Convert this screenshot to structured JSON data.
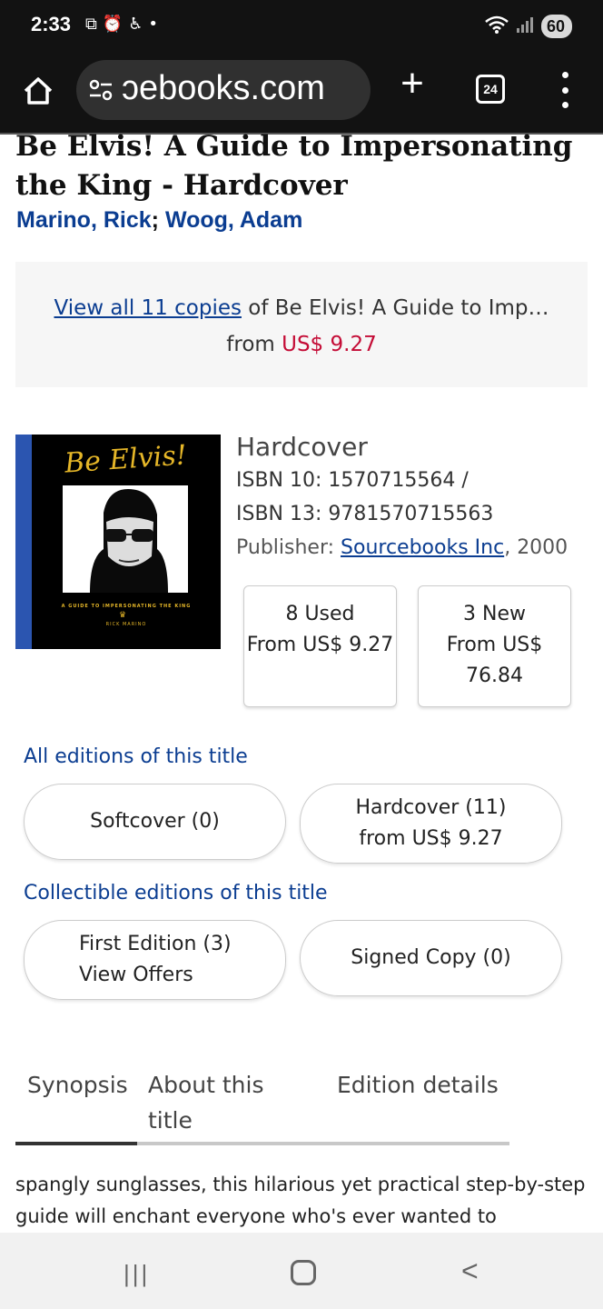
{
  "status_bar": {
    "time": "2:33",
    "battery": "60",
    "notification_icons": [
      "screenshot-icon",
      "alarm-icon",
      "accessibility-icon",
      "dot-icon"
    ]
  },
  "browser": {
    "url": "ɔebooks.com",
    "tab_count": "24"
  },
  "book": {
    "title": "Be Elvis! A Guide to Impersonating the King - Hardcover",
    "author1": "Marino, Rick",
    "author_sep": ";",
    "author2": "Woog, Adam"
  },
  "copies": {
    "link_text": "View all 11 copies",
    "rest_text": " of Be Elvis! A Guide to Imp…",
    "from_text": "from ",
    "price": "US$ 9.27"
  },
  "cover": {
    "title": "Be Elvis!",
    "subtitle": "A GUIDE TO IMPERSONATING THE KING",
    "author": "RICK MARINO"
  },
  "details": {
    "format": "Hardcover",
    "isbn10": "ISBN 10: 1570715564 /",
    "isbn13": "ISBN 13: 9781570715563",
    "publisher_label": "Publisher: ",
    "publisher": "Sourcebooks Inc",
    "year": ", 2000"
  },
  "offers": {
    "used_line1": "8 Used",
    "used_line2": "From US$ 9.27",
    "new_line1": "3 New",
    "new_line2": "From US$",
    "new_line3": "76.84"
  },
  "editions": {
    "label": "All editions of this title",
    "softcover": "Softcover (0)",
    "hardcover": "Hardcover (11)",
    "hardcover_from": "from US$ 9.27"
  },
  "collectible": {
    "label": "Collectible editions of this title",
    "first_edition": "First Edition (3)",
    "first_edition_sub": "View Offers",
    "signed": "Signed Copy (0)"
  },
  "tabs": {
    "synopsis": "Synopsis",
    "about_line1": "About this",
    "about_line2": "title",
    "edition_details": "Edition details"
  },
  "synopsis_text": "spangly sunglasses, this hilarious yet practical step-by-step guide will enchant everyone who's ever wanted to"
}
